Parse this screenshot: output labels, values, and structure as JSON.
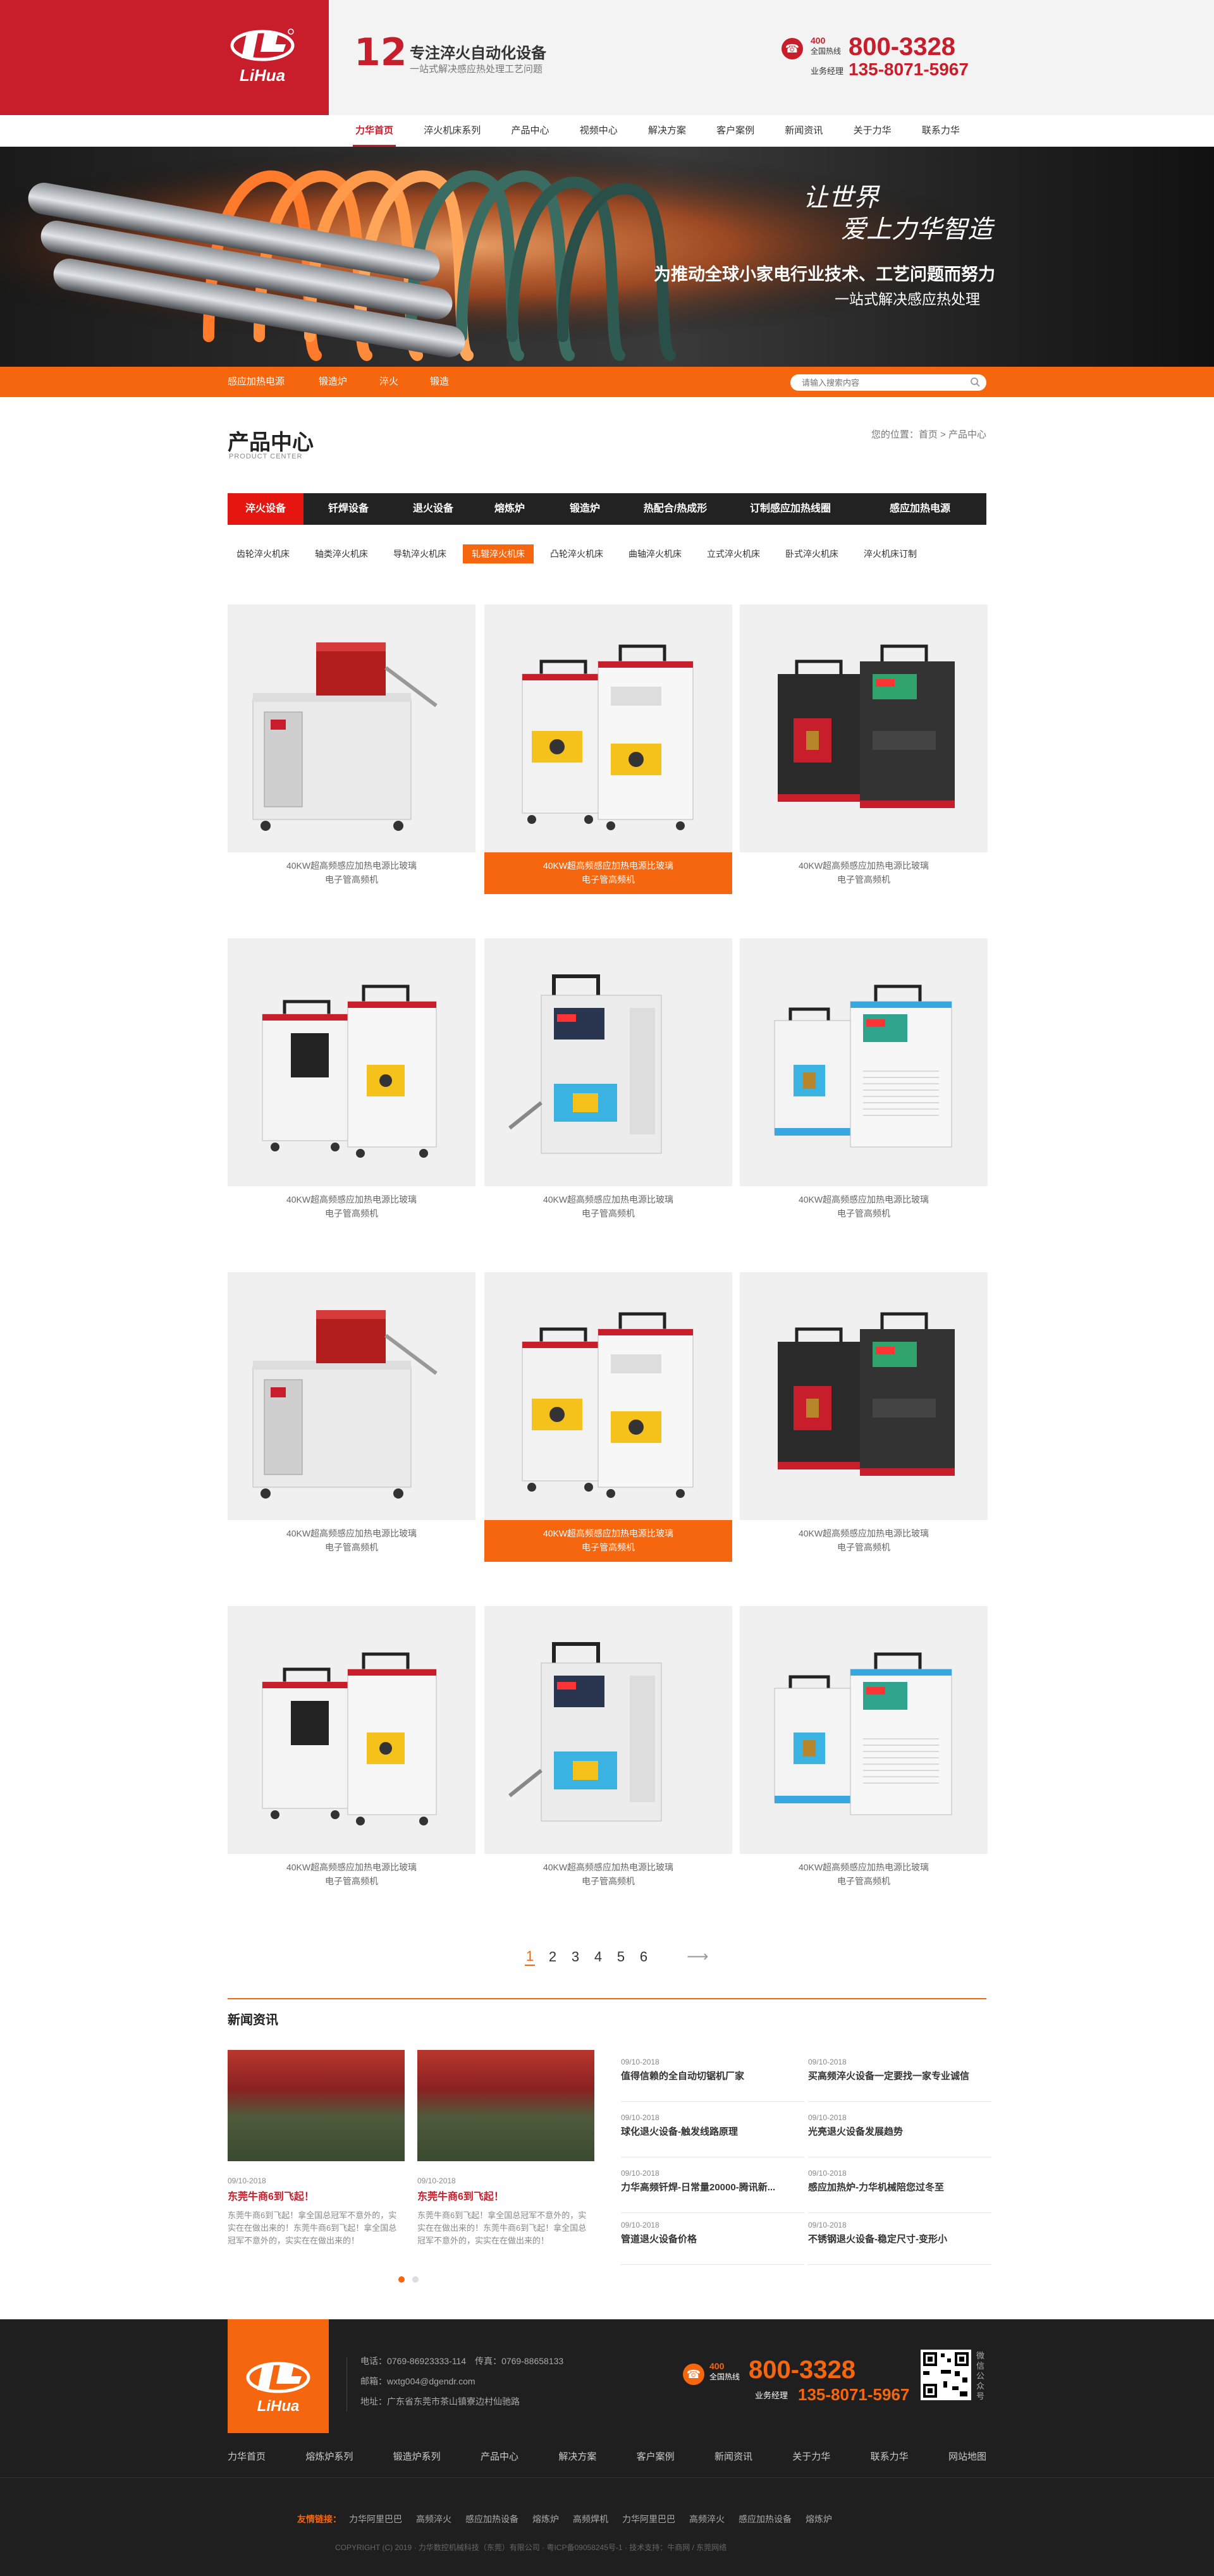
{
  "header": {
    "logo_text": "LiHua",
    "slogan_num": "12",
    "slogan_title": "专注淬火自动化设备",
    "slogan_sub": "一站式解决感应热处理工艺问题",
    "hotline_pre": "400",
    "hotline_label": "全国热线",
    "hotline": "800-3328",
    "manager_label": "业务经理",
    "manager_phone": "135-8071-5967"
  },
  "nav": [
    "力华首页",
    "淬火机床系列",
    "产品中心",
    "视频中心",
    "解决方案",
    "客户案例",
    "新闻资讯",
    "关于力华",
    "联系力华"
  ],
  "banner": {
    "script1": "让世界",
    "script2": "爱上力华智造",
    "line1": "为推动全球小家电行业技术、工艺问题而努力",
    "line2": "一站式解决感应热处理"
  },
  "subnav": {
    "items": [
      "感应加热电源",
      "锻造炉",
      "淬火",
      "锻造"
    ],
    "search_placeholder": "请输入搜索内容"
  },
  "product_center": {
    "title": "产品中心",
    "subtitle": "PRODUCT CENTER",
    "breadcrumb": "您的位置：首页 > 产品中心",
    "categories": [
      "淬火设备",
      "钎焊设备",
      "退火设备",
      "熔炼炉",
      "锻造炉",
      "热配合/热成形",
      "订制感应加热线圈",
      "感应加热电源"
    ],
    "subcategories": [
      "齿轮淬火机床",
      "轴类淬火机床",
      "导轨淬火机床",
      "轧辊淬火机床",
      "凸轮淬火机床",
      "曲轴淬火机床",
      "立式淬火机床",
      "卧式淬火机床",
      "淬火机床订制"
    ],
    "products": [
      {
        "line1": "40KW超高频感应加热电源比玻璃",
        "line2": "电子管高频机"
      },
      {
        "line1": "40KW超高频感应加热电源比玻璃",
        "line2": "电子管高频机"
      },
      {
        "line1": "40KW超高频感应加热电源比玻璃",
        "line2": "电子管高频机"
      },
      {
        "line1": "40KW超高频感应加热电源比玻璃",
        "line2": "电子管高频机"
      },
      {
        "line1": "40KW超高频感应加热电源比玻璃",
        "line2": "电子管高频机"
      },
      {
        "line1": "40KW超高频感应加热电源比玻璃",
        "line2": "电子管高频机"
      },
      {
        "line1": "40KW超高频感应加热电源比玻璃",
        "line2": "电子管高频机"
      },
      {
        "line1": "40KW超高频感应加热电源比玻璃",
        "line2": "电子管高频机"
      },
      {
        "line1": "40KW超高频感应加热电源比玻璃",
        "line2": "电子管高频机"
      },
      {
        "line1": "40KW超高频感应加热电源比玻璃",
        "line2": "电子管高频机"
      },
      {
        "line1": "40KW超高频感应加热电源比玻璃",
        "line2": "电子管高频机"
      },
      {
        "line1": "40KW超高频感应加热电源比玻璃",
        "line2": "电子管高频机"
      }
    ],
    "pages": [
      "1",
      "2",
      "3",
      "4",
      "5",
      "6"
    ],
    "next": "⟶"
  },
  "news": {
    "title": "新闻资讯",
    "cards": [
      {
        "date": "09/10-2018",
        "title": "东莞牛商6到飞起！",
        "desc": "东莞牛商6到飞起！拿全国总冠军不意外的，实实在在做出来的！东莞牛商6到飞起！拿全国总冠军不意外的，实实在在做出来的！"
      },
      {
        "date": "09/10-2018",
        "title": "东莞牛商6到飞起！",
        "desc": "东莞牛商6到飞起！拿全国总冠军不意外的，实实在在做出来的！东莞牛商6到飞起！拿全国总冠军不意外的，实实在在做出来的！"
      }
    ],
    "items": [
      {
        "date": "09/10-2018",
        "title": "值得信赖的全自动切锯机厂家"
      },
      {
        "date": "09/10-2018",
        "title": "买高频淬火设备一定要找一家专业诚信"
      },
      {
        "date": "09/10-2018",
        "title": "球化退火设备-触发线路原理"
      },
      {
        "date": "09/10-2018",
        "title": "光亮退火设备发展趋势"
      },
      {
        "date": "09/10-2018",
        "title": "力华高频钎焊-日常量20000-腾讯新..."
      },
      {
        "date": "09/10-2018",
        "title": "感应加热炉-力华机械陪您过冬至"
      },
      {
        "date": "09/10-2018",
        "title": "管道退火设备价格"
      },
      {
        "date": "09/10-2018",
        "title": "不锈钢退火设备-稳定尺寸-变形小"
      }
    ]
  },
  "footer": {
    "logo_text": "LiHua",
    "contact": [
      "电话：0769-86923333-114　传真：0769-88658133",
      "邮箱：wxtg004@dgendr.com",
      "地址：广东省东莞市茶山镇寮边村仙驰路"
    ],
    "hotline_pre": "400",
    "hotline_label": "全国热线",
    "hotline": "800-3328",
    "manager_label": "业务经理",
    "manager_phone": "135-8071-5967",
    "qr_label": "微信公众号",
    "nav": [
      "力华首页",
      "熔炼炉系列",
      "锻造炉系列",
      "产品中心",
      "解决方案",
      "客户案例",
      "新闻资讯",
      "关于力华",
      "联系力华",
      "网站地图"
    ],
    "links_label": "友情链接：",
    "links": [
      "力华阿里巴巴",
      "高频淬火",
      "感应加热设备",
      "熔炼炉",
      "高频焊机",
      "力华阿里巴巴",
      "高频淬火",
      "感应加热设备",
      "熔炼炉"
    ],
    "copyright": "COPYRIGHT (C) 2019 · 力华数控机械科技（东莞）有限公司 · 粤ICP备09058245号-1 · 技术支持：牛商网 / 东莞网络"
  },
  "colors": {
    "brand_red": "#c81e2c",
    "accent_orange": "#f5660f",
    "dark": "#222222"
  }
}
